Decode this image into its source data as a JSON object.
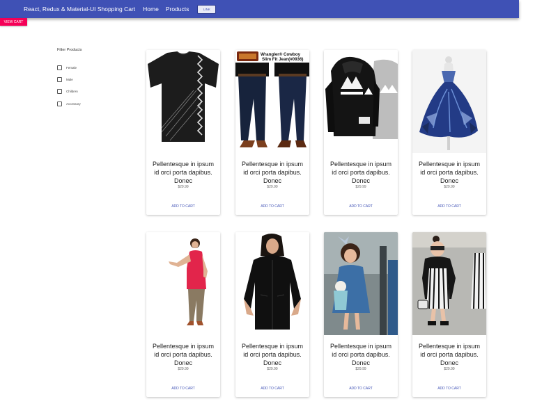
{
  "appbar": {
    "title": "React, Redux & Material-UI Shopping Cart",
    "nav": [
      "Home",
      "Products"
    ],
    "link_button": "LINK",
    "color": "#3f51b5"
  },
  "view_cart_button": {
    "label": "VIEW CART",
    "color": "#f50057"
  },
  "filter": {
    "title": "Filter Products",
    "options": [
      {
        "label": "Female",
        "checked": false
      },
      {
        "label": "Male",
        "checked": false
      },
      {
        "label": "Children",
        "checked": false
      },
      {
        "label": "Accessory",
        "checked": false
      }
    ]
  },
  "products": [
    {
      "title": "Pellentesque in ipsum id orci porta dapibus. Donec",
      "price": "$29.99",
      "button": "ADD TO CART",
      "image": "black-tshirt"
    },
    {
      "title": "Pellentesque in ipsum id orci porta dapibus. Donec",
      "price": "$29.99",
      "button": "ADD TO CART",
      "image": "wrangler-jeans",
      "image_caption": "Wrangler® Cowboy Slim Fit Jean(#0936)"
    },
    {
      "title": "Pellentesque in ipsum id orci porta dapibus. Donec",
      "price": "$29.99",
      "button": "ADD TO CART",
      "image": "adidas-hoodie"
    },
    {
      "title": "Pellentesque in ipsum id orci porta dapibus. Donec",
      "price": "$29.99",
      "button": "ADD TO CART",
      "image": "blue-gown"
    },
    {
      "title": "Pellentesque in ipsum id orci porta dapibus. Donec",
      "price": "$29.99",
      "button": "ADD TO CART",
      "image": "red-top"
    },
    {
      "title": "Pellentesque in ipsum id orci porta dapibus. Donec",
      "price": "$29.99",
      "button": "ADD TO CART",
      "image": "black-fleece-jacket"
    },
    {
      "title": "Pellentesque in ipsum id orci porta dapibus. Donec",
      "price": "$29.99",
      "button": "ADD TO CART",
      "image": "girl-denim-dress"
    },
    {
      "title": "Pellentesque in ipsum id orci porta dapibus. Donec",
      "price": "$29.99",
      "button": "ADD TO CART",
      "image": "girl-striped-outfit"
    }
  ]
}
